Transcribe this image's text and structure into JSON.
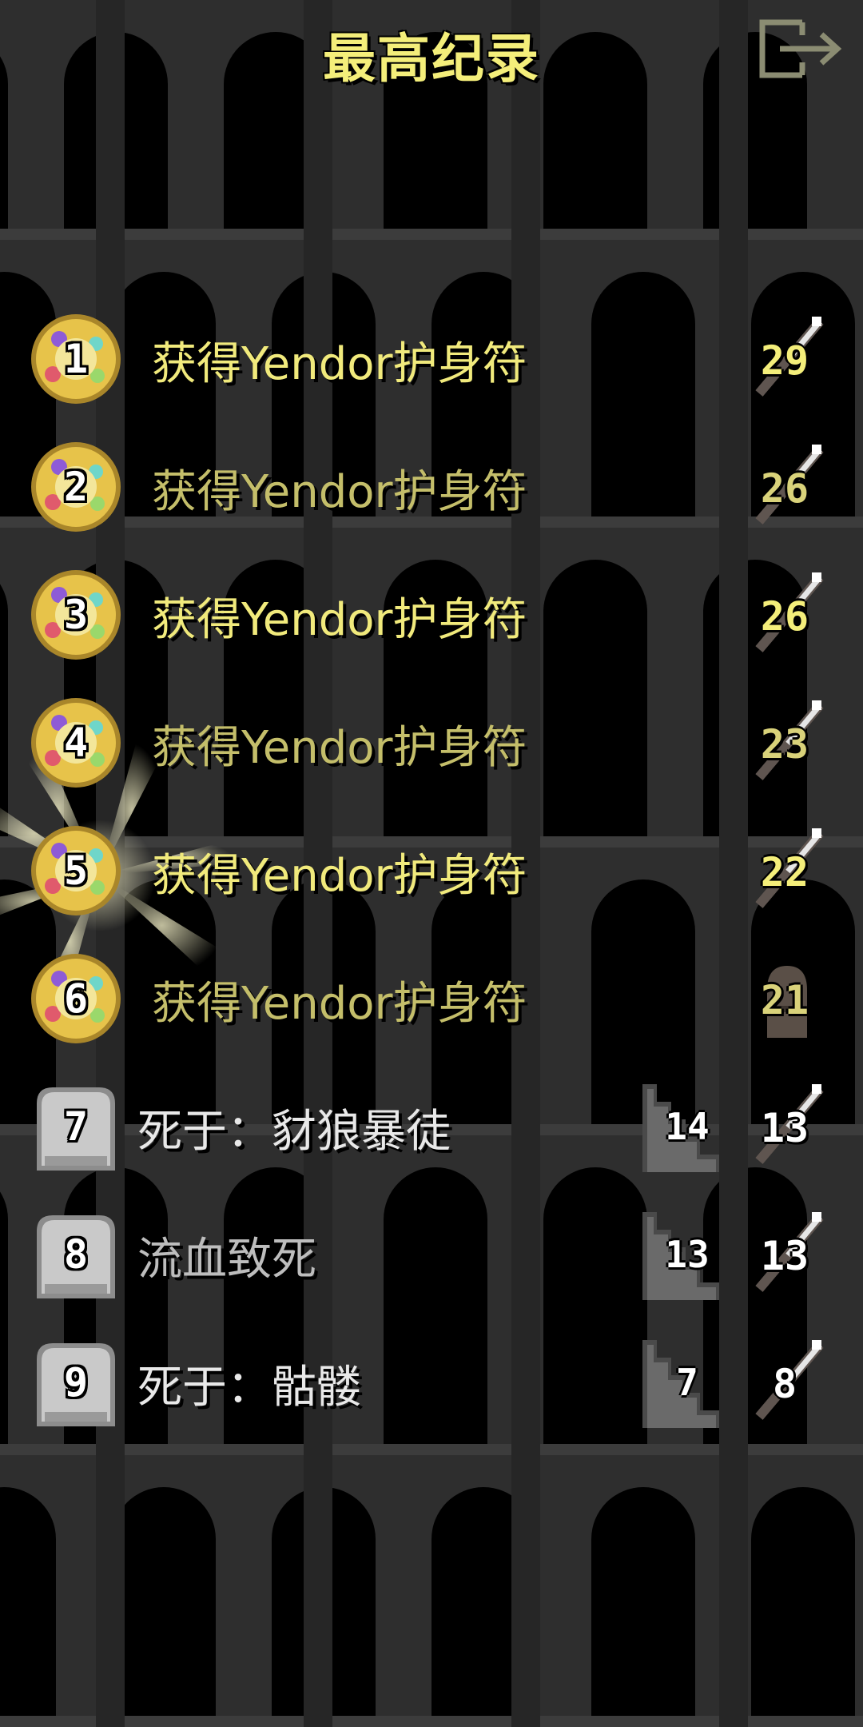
{
  "header": {
    "title": "最高纪录",
    "exit_icon": "exit-door-icon"
  },
  "records": [
    {
      "rank": "1",
      "description": "获得Yendor护身符",
      "level": "29",
      "depth": "",
      "win": true,
      "highlight": true
    },
    {
      "rank": "2",
      "description": "获得Yendor护身符",
      "level": "26",
      "depth": "",
      "win": true,
      "highlight": false
    },
    {
      "rank": "3",
      "description": "获得Yendor护身符",
      "level": "26",
      "depth": "",
      "win": true,
      "highlight": true
    },
    {
      "rank": "4",
      "description": "获得Yendor护身符",
      "level": "23",
      "depth": "",
      "win": true,
      "highlight": false
    },
    {
      "rank": "5",
      "description": "获得Yendor护身符",
      "level": "22",
      "depth": "",
      "win": true,
      "highlight": true
    },
    {
      "rank": "6",
      "description": "获得Yendor护身符",
      "level": "21",
      "depth": "",
      "win": true,
      "highlight": false
    },
    {
      "rank": "7",
      "description": "死于：豺狼暴徒",
      "level": "13",
      "depth": "14",
      "win": false,
      "highlight": true
    },
    {
      "rank": "8",
      "description": "流血致死",
      "level": "13",
      "depth": "13",
      "win": false,
      "highlight": false
    },
    {
      "rank": "9",
      "description": "死于：骷髅",
      "level": "8",
      "depth": "7",
      "win": false,
      "highlight": true
    }
  ],
  "colors": {
    "gold_text": "#f4ee7a",
    "medal_gold": "#e7c34a",
    "grave_stone": "#c9c9c9",
    "pillar": "#3a3a3a"
  }
}
